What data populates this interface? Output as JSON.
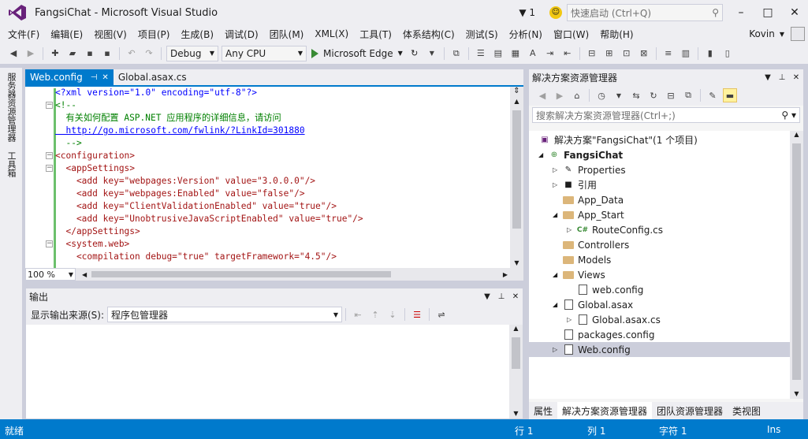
{
  "window": {
    "title": "FangsiChat - Microsoft Visual Studio",
    "notification_count": "1",
    "quick_launch_placeholder": "快速启动 (Ctrl+Q)",
    "controls": [
      "–",
      "□",
      "✕"
    ]
  },
  "menu": {
    "items": [
      "文件(F)",
      "编辑(E)",
      "视图(V)",
      "项目(P)",
      "生成(B)",
      "调试(D)",
      "团队(M)",
      "XML(X)",
      "工具(T)",
      "体系结构(C)",
      "测试(S)",
      "分析(N)",
      "窗口(W)",
      "帮助(H)"
    ],
    "user": "Kovin"
  },
  "toolbar": {
    "config": "Debug",
    "platform": "Any CPU",
    "run_target": "Microsoft Edge"
  },
  "left_strip": {
    "tabs": [
      "服务器资源管理器",
      "工具箱"
    ]
  },
  "editor": {
    "tabs": [
      {
        "label": "Web.config",
        "active": true
      },
      {
        "label": "Global.asax.cs",
        "active": false
      }
    ],
    "zoom": "100 %",
    "lines": {
      "l1": "<?xml version=\"1.0\" encoding=\"utf-8\"?>",
      "l2": "<!--",
      "l3": "  有关如何配置 ASP.NET 应用程序的详细信息，请访问",
      "l4": "  http://go.microsoft.com/fwlink/?LinkId=301880",
      "l5": "  -->",
      "l6": "<configuration>",
      "l7": "  <appSettings>",
      "l8": "    <add key=\"webpages:Version\" value=\"3.0.0.0\"/>",
      "l9": "    <add key=\"webpages:Enabled\" value=\"false\"/>",
      "l10": "    <add key=\"ClientValidationEnabled\" value=\"true\"/>",
      "l11": "    <add key=\"UnobtrusiveJavaScriptEnabled\" value=\"true\"/>",
      "l12": "  </appSettings>",
      "l13": "  <system.web>",
      "l14": "    <compilation debug=\"true\" targetFramework=\"4.5\"/>"
    }
  },
  "output": {
    "title": "输出",
    "source_label": "显示输出来源(S):",
    "source_value": "程序包管理器"
  },
  "solution_explorer": {
    "title": "解决方案资源管理器",
    "search_placeholder": "搜索解决方案资源管理器(Ctrl+;)",
    "items": [
      {
        "label": "解决方案\"FangsiChat\"(1 个项目)",
        "icon": "solution-icon"
      },
      {
        "label": "FangsiChat",
        "icon": "project-icon"
      },
      {
        "label": "Properties",
        "icon": "wrench-icon"
      },
      {
        "label": "引用",
        "icon": "reference-icon"
      },
      {
        "label": "App_Data",
        "icon": "folder-icon"
      },
      {
        "label": "App_Start",
        "icon": "folder-open-icon"
      },
      {
        "label": "RouteConfig.cs",
        "icon": "csharp-file-icon"
      },
      {
        "label": "Controllers",
        "icon": "folder-icon"
      },
      {
        "label": "Models",
        "icon": "folder-icon"
      },
      {
        "label": "Views",
        "icon": "folder-open-icon"
      },
      {
        "label": "web.config",
        "icon": "config-file-icon"
      },
      {
        "label": "Global.asax",
        "icon": "config-file-icon"
      },
      {
        "label": "Global.asax.cs",
        "icon": "config-file-icon"
      },
      {
        "label": "packages.config",
        "icon": "config-file-icon"
      },
      {
        "label": "Web.config",
        "icon": "config-file-icon"
      }
    ],
    "bottom_tabs": [
      "属性",
      "解决方案资源管理器",
      "团队资源管理器",
      "类视图"
    ]
  },
  "status": {
    "ready": "就绪",
    "line": "行 1",
    "col": "列 1",
    "char": "字符 1",
    "mode": "Ins"
  },
  "colors": {
    "accent": "#007ACC",
    "chrome": "#EEEEF2"
  }
}
